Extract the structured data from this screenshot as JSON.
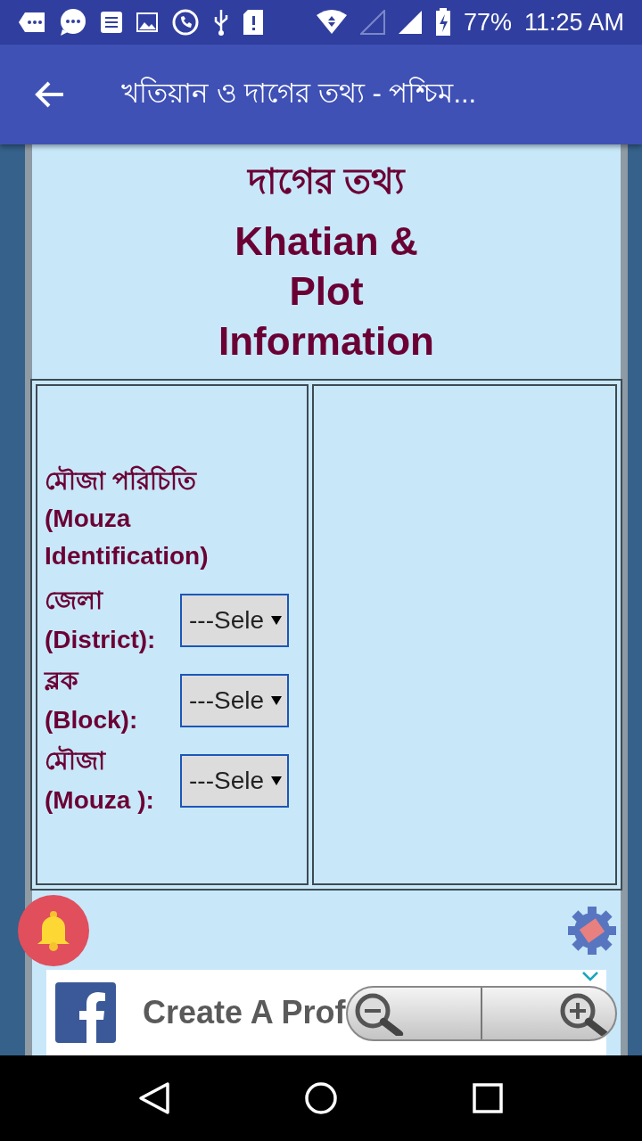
{
  "status_bar": {
    "battery": "77%",
    "time": "11:25 AM"
  },
  "app_bar": {
    "title": "খতিয়ান ও দাগের তথ্য - পশ্চিম..."
  },
  "page": {
    "heading_bn": "দাগের তথ্য",
    "heading_en": "Khatian & Plot Information",
    "section_title": "মৌজা পরিচিতি (Mouza Identification)",
    "fields": [
      {
        "label_bn": "জেলা",
        "label_en": "(District):",
        "value": "---Sele"
      },
      {
        "label_bn": "ব্লক",
        "label_en": "(Block):",
        "value": "---Sele"
      },
      {
        "label_bn": "মৌজা",
        "label_en": "(Mouza ):",
        "value": "---Sele"
      }
    ]
  },
  "ad": {
    "text": "Create A Prof"
  }
}
